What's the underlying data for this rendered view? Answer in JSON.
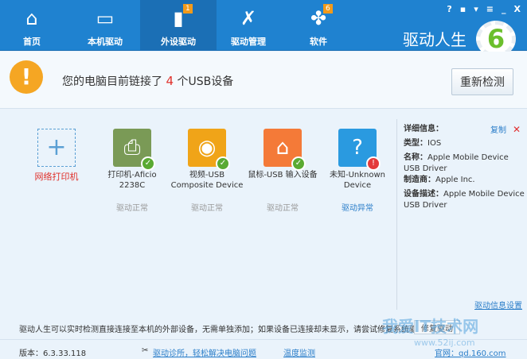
{
  "nav": {
    "tabs": [
      {
        "label": "首页",
        "icon": "home-icon"
      },
      {
        "label": "本机驱动",
        "icon": "monitor-icon"
      },
      {
        "label": "外设驱动",
        "icon": "usb-icon",
        "badge": "1"
      },
      {
        "label": "驱动管理",
        "icon": "tools-icon"
      },
      {
        "label": "软件",
        "icon": "clover-icon",
        "badge": "6"
      }
    ],
    "brand": "驱动人生",
    "logo_digit": "6"
  },
  "window": {
    "help": "?",
    "feedback": "▪",
    "skin": "▾",
    "menu": "≡",
    "minimize": "_",
    "close": "X"
  },
  "alert": {
    "prefix": "您的电脑目前链接了",
    "count": "4",
    "suffix": "个USB设备",
    "rescan": "重新检测"
  },
  "devices": [
    {
      "name": "网络打印机"
    },
    {
      "name": "打印机-Aficio 2238C",
      "status": "驱动正常",
      "color": "#7a9a56"
    },
    {
      "name": "视频-USB Composite Device",
      "status": "驱动正常",
      "color": "#f0a418"
    },
    {
      "name": "鼠标-USB 输入设备",
      "status": "驱动正常",
      "color": "#f47a38"
    },
    {
      "name": "未知-Unknown Device",
      "status": "驱动异常",
      "color": "#2a9ae0"
    }
  ],
  "detail": {
    "title": "详细信息：",
    "copy": "复制",
    "type_label": "类型：",
    "type": "IOS",
    "name_label": "名称：",
    "name": "Apple Mobile Device USB Driver",
    "maker_label": "制造商：",
    "maker": "Apple Inc.",
    "desc_label": "设备描述：",
    "desc": "Apple Mobile Device USB Driver",
    "settings": "驱动信息设置"
  },
  "notice": {
    "text": "驱动人生可以实时检测直接连接至本机的外部设备，无需单独添加；如果设备已连接却未显示，请尝试修复系统驱动。",
    "repair": "修复驱动"
  },
  "footer": {
    "version": "版本：6.3.33.118",
    "diag": "驱动诊所，轻松解决电脑问题",
    "temp": "温度监测",
    "site": "官网：qd.160.com"
  },
  "watermark": {
    "title": "我爱IT技术网",
    "url": "www.52ij.com"
  }
}
